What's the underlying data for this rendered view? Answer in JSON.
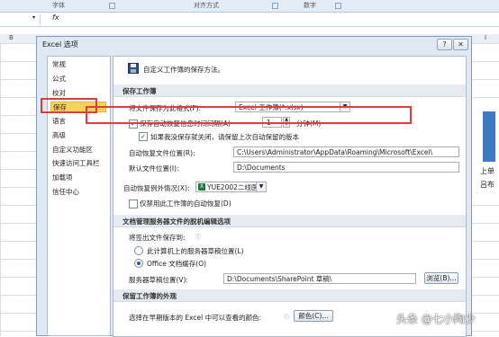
{
  "ribbon": {
    "groups": [
      "字体",
      "对齐方式",
      "数字"
    ]
  },
  "formula_bar": {
    "fx": "fx"
  },
  "column_header": {
    "first": "B",
    "right": "I"
  },
  "sheet_right": {
    "line1": "上单",
    "line2": "吕布"
  },
  "dialog": {
    "title": "Excel 选项",
    "help_label": "?",
    "close_label": "✕",
    "nav": [
      "常规",
      "公式",
      "校对",
      "保存",
      "语言",
      "高级",
      "自定义功能区",
      "快速访问工具栏",
      "加载项",
      "信任中心"
    ],
    "nav_selected_index": 3
  },
  "content": {
    "intro": "自定义工作簿的保存方法。",
    "sec_save": "保存工作簿",
    "format_label": "将文件保存为此格式(F):",
    "format_value": "Excel 工作簿(*.xlsx)",
    "autorecover_label": "保存自动恢复信息时间间隔(A)",
    "autorecover_checked": true,
    "autorecover_minutes": "1",
    "minutes_label": "分钟(M)",
    "keep_last_label": "如果我没保存就关闭，请保留上次自动保留的版本",
    "keep_last_checked": true,
    "ar_location_label": "自动恢复文件位置(R):",
    "ar_location_value": "C:\\Users\\Administrator\\AppData\\Roaming\\Microsoft\\Excel\\",
    "default_location_label": "默认文件位置(I):",
    "default_location_value": "D:\\Documents",
    "exceptions_label": "自动恢复例外情况(X):",
    "exceptions_value": "YUE2002二线医...",
    "disable_ar_label": "仅禁用此工作簿的自动恢复(D)",
    "sec_offline": "文档管理服务器文件的脱机编辑选项",
    "checkout_label": "将签出文件保存到:",
    "radio_server": "此计算机上的服务器草稿位置(L)",
    "radio_cache": "Office 文档缓存(O)",
    "server_drafts_label": "服务器草稿位置(V):",
    "server_drafts_value": "D:\\Documents\\SharePoint 草稿\\",
    "browse_label": "浏览(B)...",
    "sec_appearance": "保留工作簿的外观",
    "colors_label": "选择在早期版本的 Excel 中可以查看的颜色:",
    "colors_button": "颜色(C)..."
  },
  "watermark": "头条 @七小陶少"
}
